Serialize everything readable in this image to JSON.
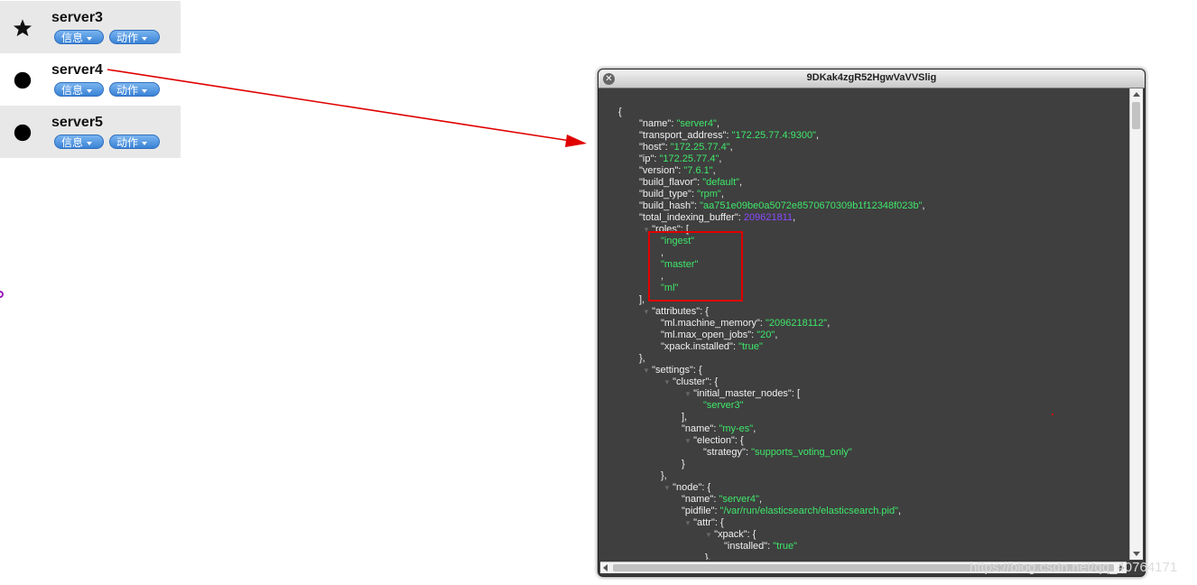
{
  "servers": [
    {
      "name": "server3",
      "icon": "star-icon",
      "info_label": "信息",
      "action_label": "动作"
    },
    {
      "name": "server4",
      "icon": "circle-icon",
      "info_label": "信息",
      "action_label": "动作"
    },
    {
      "name": "server5",
      "icon": "circle-icon",
      "info_label": "信息",
      "action_label": "动作"
    }
  ],
  "dialog": {
    "title": "9DKak4zgR52HgwVaVVSlig",
    "close_icon": "close-icon",
    "lines": [
      {
        "t": "{"
      },
      {
        "k": "\"name\": ",
        "v": "\"server4\"",
        "p": ","
      },
      {
        "k": "\"transport_address\": ",
        "v": "\"172.25.77.4:9300\"",
        "p": ","
      },
      {
        "k": "\"host\": ",
        "v": "\"172.25.77.4\"",
        "p": ","
      },
      {
        "k": "\"ip\": ",
        "v": "\"172.25.77.4\"",
        "p": ","
      },
      {
        "k": "\"version\": ",
        "v": "\"7.6.1\"",
        "p": ","
      },
      {
        "k": "\"build_flavor\": ",
        "v": "\"default\"",
        "p": ","
      },
      {
        "k": "\"build_type\": ",
        "v": "\"rpm\"",
        "p": ","
      },
      {
        "k": "\"build_hash\": ",
        "v": "\"aa751e09be0a5072e8570670309b1f12348f023b\"",
        "p": ","
      },
      {
        "k": "\"total_indexing_buffer\": ",
        "v": "209621811",
        "p": ",",
        "num": true
      },
      {
        "k": "\"roles\": [",
        "tri": true
      },
      {
        "v": "\"ingest\""
      },
      {
        "t": ","
      },
      {
        "v": "\"master\""
      },
      {
        "t": ","
      },
      {
        "v": "\"ml\""
      },
      {
        "t": "],"
      },
      {
        "k": "\"attributes\": {",
        "tri": true
      },
      {
        "k": "\"ml.machine_memory\": ",
        "v": "\"2096218112\"",
        "p": ","
      },
      {
        "k": "\"ml.max_open_jobs\": ",
        "v": "\"20\"",
        "p": ","
      },
      {
        "k": "\"xpack.installed\": ",
        "v": "\"true\""
      },
      {
        "t": "},"
      },
      {
        "k": "\"settings\": {",
        "tri": true
      },
      {
        "k": "\"cluster\": {",
        "tri": true
      },
      {
        "k": "\"initial_master_nodes\": [",
        "tri": true
      },
      {
        "v": "\"server3\""
      },
      {
        "t": "],"
      },
      {
        "k": "\"name\": ",
        "v": "\"my-es\"",
        "p": ","
      },
      {
        "k": "\"election\": {",
        "tri": true
      },
      {
        "k": "\"strategy\": ",
        "v": "\"supports_voting_only\""
      },
      {
        "t": "}"
      },
      {
        "t": "},"
      },
      {
        "k": "\"node\": {",
        "tri": true
      },
      {
        "k": "\"name\": ",
        "v": "\"server4\"",
        "p": ","
      },
      {
        "k": "\"pidfile\": ",
        "v": "\"/var/run/elasticsearch/elasticsearch.pid\"",
        "p": ","
      },
      {
        "k": "\"attr\": {",
        "tri": true
      },
      {
        "k": "\"xpack\": {",
        "tri": true
      },
      {
        "k": "\"installed\": ",
        "v": "\"true\""
      },
      {
        "t": "},"
      }
    ]
  },
  "watermark": "https://blog.csdn.net/qq_40764171"
}
